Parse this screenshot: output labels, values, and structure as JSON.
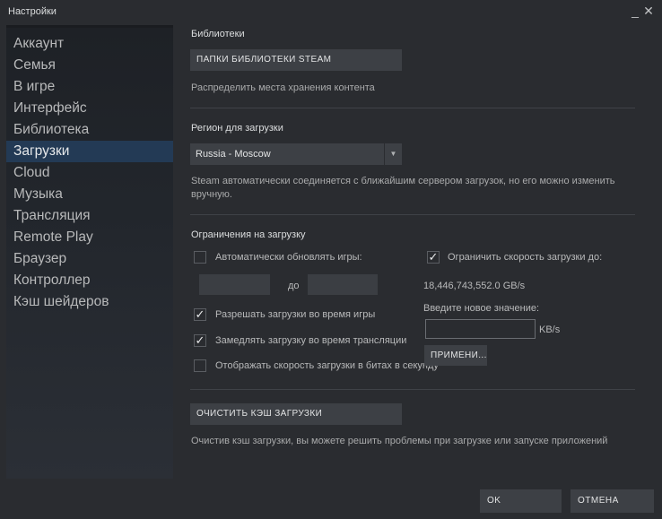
{
  "window": {
    "title": "Настройки",
    "minimize": "_",
    "close": "✕"
  },
  "sidebar": {
    "items": [
      {
        "label": "Аккаунт"
      },
      {
        "label": "Семья"
      },
      {
        "label": "В игре"
      },
      {
        "label": "Интерфейс"
      },
      {
        "label": "Библиотека"
      },
      {
        "label": "Загрузки",
        "active": true
      },
      {
        "label": "Cloud"
      },
      {
        "label": "Музыка"
      },
      {
        "label": "Трансляция"
      },
      {
        "label": "Remote Play"
      },
      {
        "label": "Браузер"
      },
      {
        "label": "Контроллер"
      },
      {
        "label": "Кэш шейдеров"
      }
    ]
  },
  "libraries": {
    "title": "Библиотеки",
    "button_label": "ПАПКИ БИБЛИОТЕКИ STEAM",
    "description": "Распределить места хранения контента"
  },
  "region": {
    "title": "Регион для загрузки",
    "selected": "Russia - Moscow",
    "description": "Steam автоматически соединяется с ближайшим сервером загрузок, но его можно изменить вручную."
  },
  "limits": {
    "title": "Ограничения на загрузку",
    "auto_update_label": "Автоматически обновлять игры:",
    "auto_update_checked": false,
    "to_label": "до",
    "allow_in_game_label": "Разрешать загрузки во время игры",
    "allow_in_game_checked": true,
    "throttle_broadcast_label": "Замедлять загрузку во время трансляции",
    "throttle_broadcast_checked": true,
    "show_bits_label": "Отображать скорость загрузки в битах в секунду",
    "show_bits_checked": false,
    "limit_speed_label": "Ограничить скорость загрузки до:",
    "limit_speed_checked": true,
    "current_limit": "18,446,743,552.0 GB/s",
    "new_value_label": "Введите новое значение:",
    "unit_label": "KB/s",
    "apply_label": "ПРИМЕНИ..."
  },
  "cache": {
    "button_label": "ОЧИСТИТЬ КЭШ ЗАГРУЗКИ",
    "description": "Очистив кэш загрузки, вы можете решить проблемы при загрузке или запуске приложений"
  },
  "footer": {
    "ok_label": "OK",
    "cancel_label": "ОТМЕНА"
  },
  "colors": {
    "background": "#2a2c30",
    "sidebar_active": "#233a55",
    "button": "#3d4045"
  }
}
